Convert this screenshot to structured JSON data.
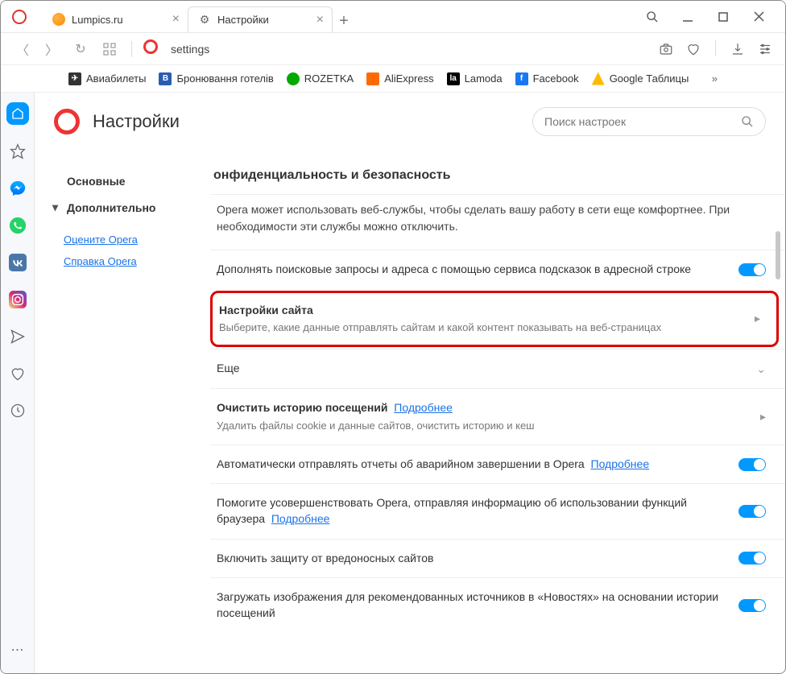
{
  "tabs": [
    {
      "title": "Lumpics.ru"
    },
    {
      "title": "Настройки"
    }
  ],
  "address": "settings",
  "toolbar_icons": {
    "camera": "camera-icon",
    "heart": "heart-icon",
    "download": "download-icon",
    "menu": "menu-icon"
  },
  "bookmarks": [
    {
      "label": "Авиабилеты",
      "bg": "#333",
      "letter": ""
    },
    {
      "label": "Бронювання готелів",
      "bg": "#2a5db0",
      "letter": "B"
    },
    {
      "label": "ROZETKA",
      "bg": "#0a0",
      "letter": ""
    },
    {
      "label": "AliExpress",
      "bg": "#ff6a00",
      "letter": ""
    },
    {
      "label": "Lamoda",
      "bg": "#000",
      "letter": "la"
    },
    {
      "label": "Facebook",
      "bg": "#1877f2",
      "letter": "f"
    },
    {
      "label": "Google Таблицы",
      "bg": "#ffb900",
      "letter": ""
    }
  ],
  "header": {
    "title": "Настройки",
    "search_placeholder": "Поиск настроек"
  },
  "nav": {
    "basic": "Основные",
    "advanced": "Дополнительно"
  },
  "links": {
    "rate": "Оцените Opera",
    "help": "Справка Opera"
  },
  "section": {
    "title": "онфиденциальность и безопасность",
    "intro": "Opera может использовать веб-службы, чтобы сделать вашу работу в сети еще комфортнее. При необходимости эти службы можно отключить.",
    "autocomplete": "Дополнять поисковые запросы и адреса с помощью сервиса подсказок в адресной строке",
    "site_title": "Настройки сайта",
    "site_sub": "Выберите, какие данные отправлять сайтам и какой контент показывать на веб-страницах",
    "more": "Еще",
    "clear_title": "Очистить историю посещений",
    "clear_sub": "Удалить файлы cookie и данные сайтов, очистить историю и кеш",
    "learn_more": "Подробнее",
    "crash": "Автоматически отправлять отчеты об аварийном завершении в Opera",
    "improve": "Помогите усовершенствовать Opera, отправляя информацию об использовании функций браузера",
    "malware": "Включить защиту от вредоносных сайтов",
    "news": "Загружать изображения для рекомендованных источников в «Новостях» на основании истории посещений"
  }
}
